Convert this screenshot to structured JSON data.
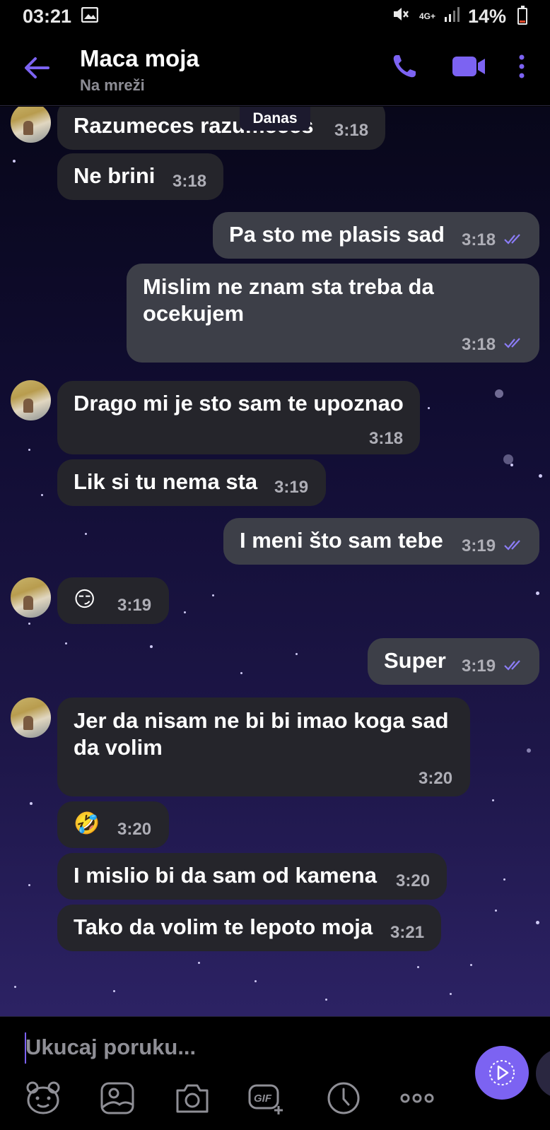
{
  "status_bar": {
    "time": "03:21",
    "network": "4G+",
    "battery": "14%",
    "icons": [
      "gallery-icon",
      "mute-icon",
      "signal-icon",
      "battery-icon"
    ]
  },
  "header": {
    "title": "Maca moja",
    "subtitle": "Na mreži",
    "icons": [
      "back-arrow-icon",
      "phone-icon",
      "video-icon",
      "more-icon"
    ]
  },
  "chat": {
    "date_label": "Danas",
    "messages": [
      {
        "direction": "in",
        "text": "Razumeces razumeces",
        "time": "3:18"
      },
      {
        "direction": "in",
        "text": "Ne brini",
        "time": "3:18"
      },
      {
        "direction": "out",
        "text": "Pa sto me plasis sad",
        "time": "3:18",
        "status": "read"
      },
      {
        "direction": "out",
        "text": "Mislim ne znam sta treba da ocekujem",
        "time": "3:18",
        "status": "read"
      },
      {
        "direction": "in",
        "text": "Drago mi je sto sam te upoznao",
        "time": "3:18"
      },
      {
        "direction": "in",
        "text": "Lik si tu nema sta",
        "time": "3:19"
      },
      {
        "direction": "out",
        "text": "I meni što sam tebe",
        "time": "3:19",
        "status": "read"
      },
      {
        "direction": "in",
        "text": "😏",
        "time": "3:19"
      },
      {
        "direction": "out",
        "text": "Super",
        "time": "3:19",
        "status": "read"
      },
      {
        "direction": "in",
        "text": "Jer da nisam ne bi bi imao koga sad da volim",
        "time": "3:20"
      },
      {
        "direction": "in",
        "text": "🤣",
        "time": "3:20"
      },
      {
        "direction": "in",
        "text": "I mislio bi da sam od kamena",
        "time": "3:20"
      },
      {
        "direction": "in",
        "text": "Tako da volim te lepoto moja",
        "time": "3:21"
      }
    ]
  },
  "composer": {
    "placeholder": "Ukucaj poruku...",
    "tools": [
      "sticker-icon",
      "gallery-icon",
      "camera-icon",
      "gif-icon",
      "clock-icon",
      "more-options-icon",
      "send-icon"
    ]
  },
  "colors": {
    "accent": "#7c63f2",
    "incoming_bubble": "#25252b",
    "outgoing_bubble": "#3d3f48",
    "read_tick": "#8b7cf6"
  }
}
